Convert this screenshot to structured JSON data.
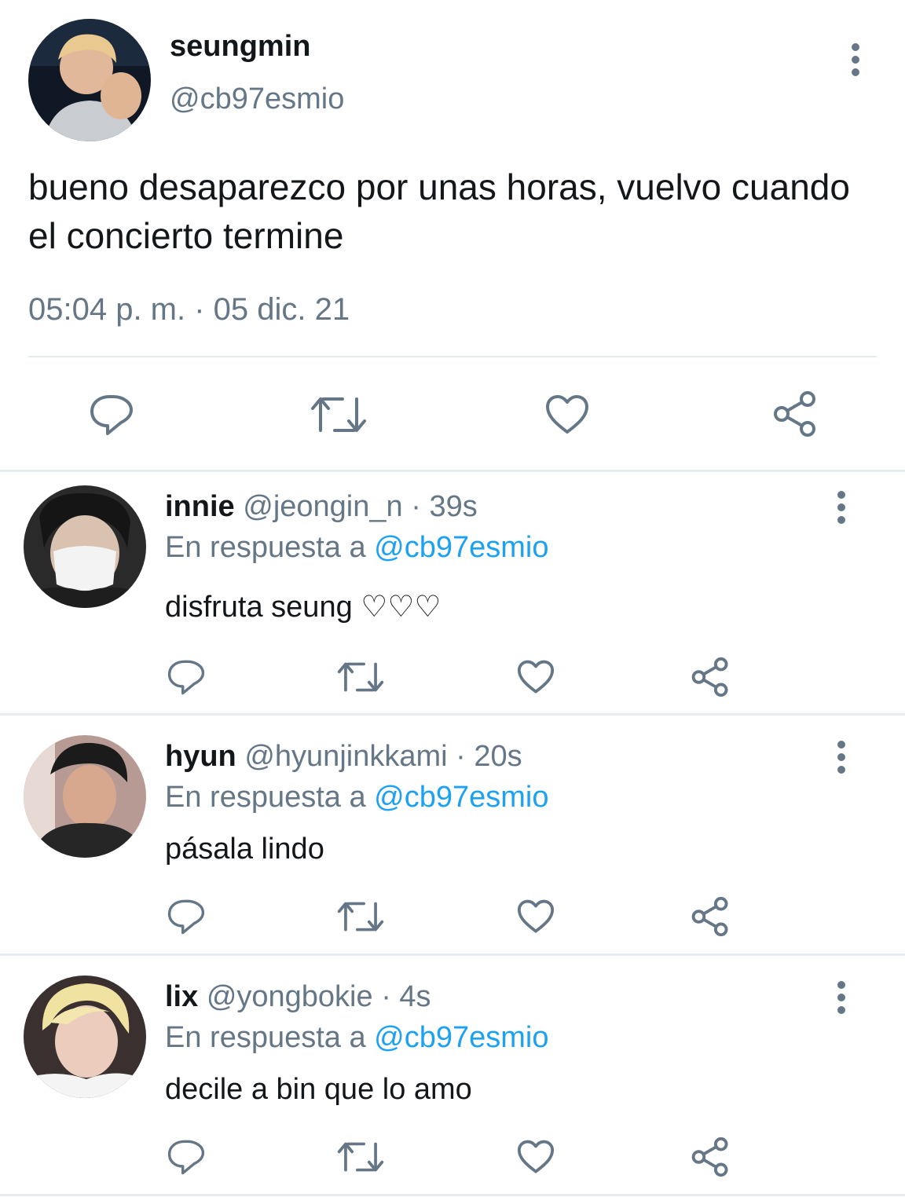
{
  "main_tweet": {
    "display_name": "seungmin",
    "handle": "@cb97esmio",
    "text": "bueno desaparezco por unas horas, vuelvo cuando el concierto termine",
    "timestamp": "05:04 p. m. · 05 dic. 21",
    "actions": [
      "reply-icon",
      "retweet-icon",
      "like-icon",
      "share-icon"
    ]
  },
  "replies": [
    {
      "display_name": "innie",
      "handle": "@jeongin_n",
      "separator": "·",
      "time": "39s",
      "reply_prefix": "En respuesta a",
      "reply_to": "@cb97esmio",
      "text": "disfruta seung ♡♡♡"
    },
    {
      "display_name": "hyun",
      "handle": "@hyunjinkkami",
      "separator": "·",
      "time": "20s",
      "reply_prefix": "En respuesta a",
      "reply_to": "@cb97esmio",
      "text": "pásala lindo"
    },
    {
      "display_name": "lix",
      "handle": "@yongbokie",
      "separator": "·",
      "time": "4s",
      "reply_prefix": "En respuesta a",
      "reply_to": "@cb97esmio",
      "text": "decile a bin que lo amo"
    }
  ],
  "colors": {
    "text_primary": "#14171a",
    "text_secondary": "#657786",
    "link": "#1da1f2",
    "divider": "#e6ecf0"
  }
}
